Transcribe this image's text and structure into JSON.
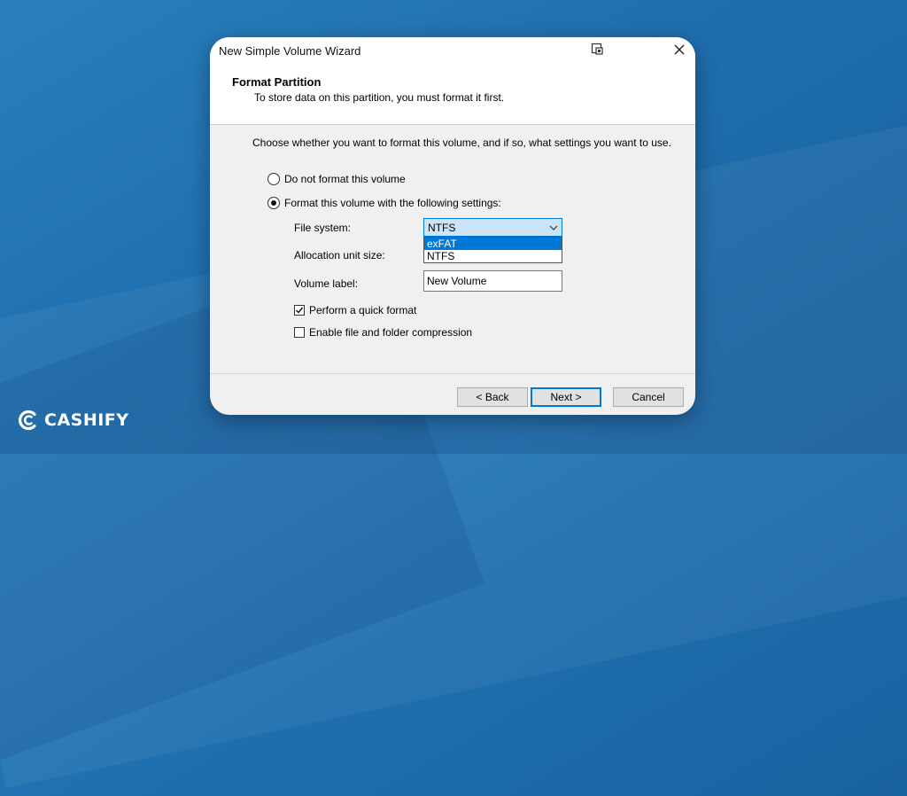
{
  "window": {
    "title": "New Simple Volume Wizard"
  },
  "header": {
    "title": "Format Partition",
    "subtitle": "To store data on this partition, you must format it first."
  },
  "body": {
    "instruction": "Choose whether you want to format this volume, and if so, what settings you want to use.",
    "radio_no_format": "Do not format this volume",
    "radio_format": "Format this volume with the following settings:",
    "selected_radio": "format"
  },
  "fields": {
    "file_system_label": "File system:",
    "file_system_value": "NTFS",
    "file_system_options": [
      "exFAT",
      "NTFS"
    ],
    "file_system_highlighted": "exFAT",
    "allocation_label": "Allocation unit size:",
    "volume_label_label": "Volume label:",
    "volume_label_value": "New Volume",
    "quick_format_label": "Perform a quick format",
    "quick_format_checked": true,
    "compression_label": "Enable file and folder compression",
    "compression_checked": false
  },
  "buttons": {
    "back": "< Back",
    "next": "Next >",
    "cancel": "Cancel"
  },
  "brand": {
    "name": "CASHIFY"
  },
  "colors": {
    "accent": "#0078d7",
    "combo_bg": "#cce4f7",
    "background": "#1e6eae"
  }
}
